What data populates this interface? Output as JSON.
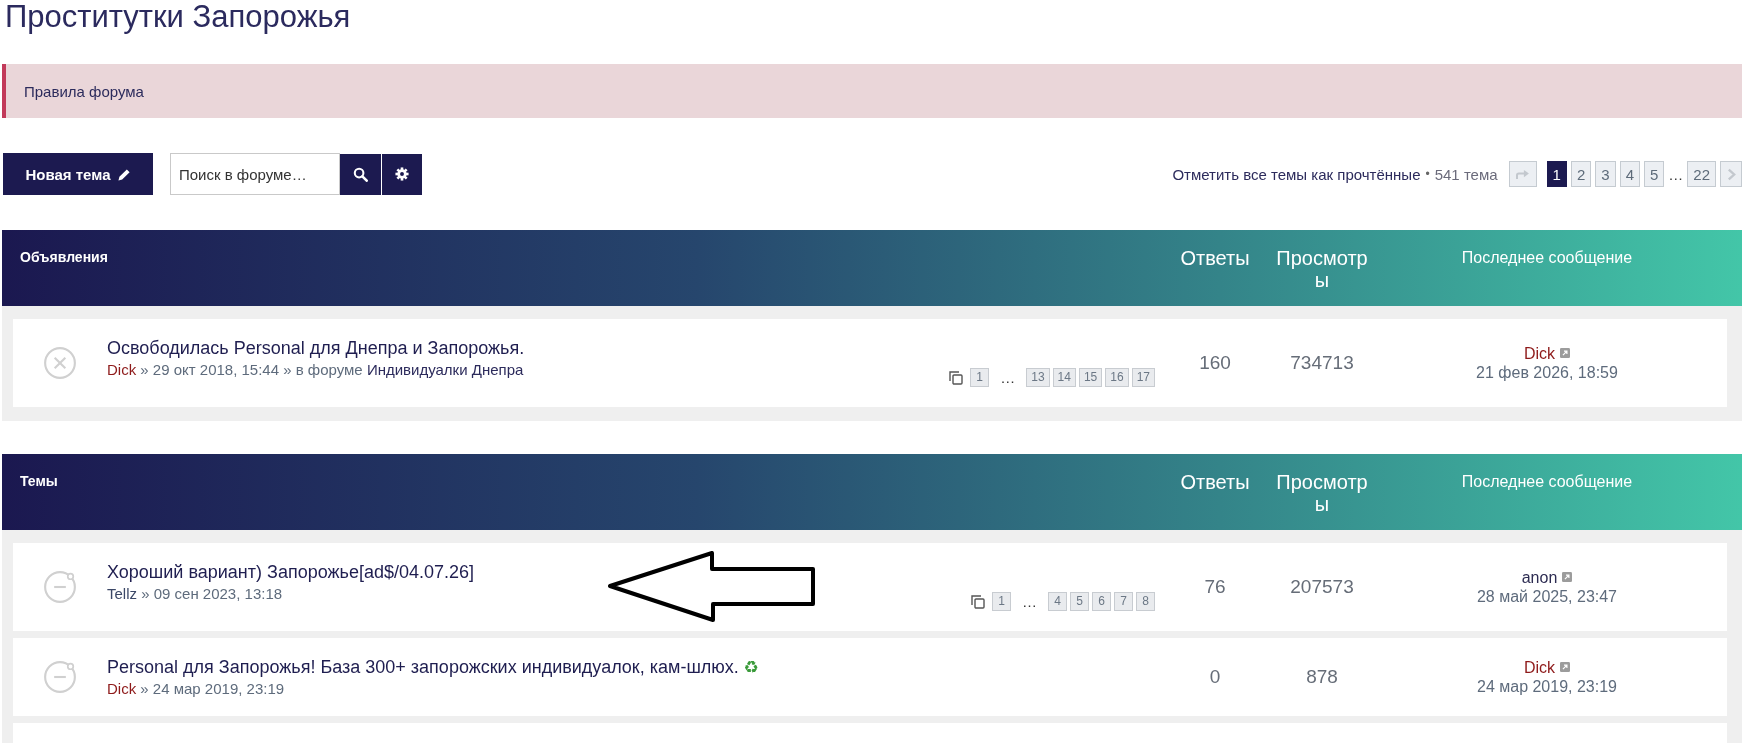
{
  "page_title": "Проститутки Запорожья",
  "rules_notice": "Правила форума",
  "toolbar": {
    "new_topic_button": "Новая тема",
    "search": {
      "placeholder": "Поиск в форуме…"
    }
  },
  "topic_actions": {
    "mark_read_link": "Отметить все темы как прочтённые",
    "separator": "•",
    "topic_count": "541 тема"
  },
  "pagination": {
    "pages": [
      {
        "kind": "page",
        "label": "1",
        "selected": true
      },
      {
        "kind": "page",
        "label": "2",
        "selected": false
      },
      {
        "kind": "page",
        "label": "3",
        "selected": false
      },
      {
        "kind": "page",
        "label": "4",
        "selected": false
      },
      {
        "kind": "page",
        "label": "5",
        "selected": false
      },
      {
        "kind": "ellipsis",
        "label": "…"
      },
      {
        "kind": "page",
        "label": "22",
        "selected": false
      }
    ]
  },
  "sections": [
    {
      "title": "Объявления",
      "columns": [
        "Ответы",
        "Просмотры",
        "Последнее сообщение"
      ],
      "topics": [
        {
          "title": "Освободилась Personal для Днепра и Запорожья.",
          "locked": true,
          "byline": {
            "author": {
              "name": "Dick",
              "color": "#8e1a1a"
            },
            "text": "» 29 окт 2018, 15:44 » в форуме",
            "forum": "Индивидуалки Днепра"
          },
          "pages": [
            {
              "kind": "page",
              "label": "1"
            },
            {
              "kind": "ellipsis",
              "label": "…"
            },
            {
              "kind": "page",
              "label": "13"
            },
            {
              "kind": "page",
              "label": "14"
            },
            {
              "kind": "page",
              "label": "15"
            },
            {
              "kind": "page",
              "label": "16"
            },
            {
              "kind": "page",
              "label": "17"
            }
          ],
          "replies": "160",
          "views": "734713",
          "last_post": {
            "author": {
              "name": "Dick",
              "color": "#8e1a1a"
            },
            "time": "21 фев 2026, 18:59"
          }
        }
      ]
    },
    {
      "title": "Темы",
      "columns": [
        "Ответы",
        "Просмотры",
        "Последнее сообщение"
      ],
      "topics": [
        {
          "title": "Хороший вариант) Запорожье[ad$/04.07.26]",
          "locked": false,
          "byline": {
            "author": {
              "name": "Tellz",
              "color": "#3b4766"
            },
            "text": "» 09 сен 2023, 13:18"
          },
          "pages": [
            {
              "kind": "page",
              "label": "1"
            },
            {
              "kind": "ellipsis",
              "label": "…"
            },
            {
              "kind": "page",
              "label": "4"
            },
            {
              "kind": "page",
              "label": "5"
            },
            {
              "kind": "page",
              "label": "6"
            },
            {
              "kind": "page",
              "label": "7"
            },
            {
              "kind": "page",
              "label": "8"
            }
          ],
          "replies": "76",
          "views": "207573",
          "last_post": {
            "author": {
              "name": "anon",
              "color": "#2d2c52"
            },
            "time": "28 май 2025, 23:47"
          }
        },
        {
          "title": "Personal для Запорожья! База 300+ запорожских индивидуалок, кам-шлюх.",
          "emoji": "♻",
          "locked": false,
          "byline": {
            "author": {
              "name": "Dick",
              "color": "#8e1a1a"
            },
            "text": "» 24 мар 2019, 23:19"
          },
          "replies": "0",
          "views": "878",
          "last_post": {
            "author": {
              "name": "Dick",
              "color": "#8e1a1a"
            },
            "time": "24 мар 2019, 23:19"
          }
        }
      ]
    }
  ]
}
